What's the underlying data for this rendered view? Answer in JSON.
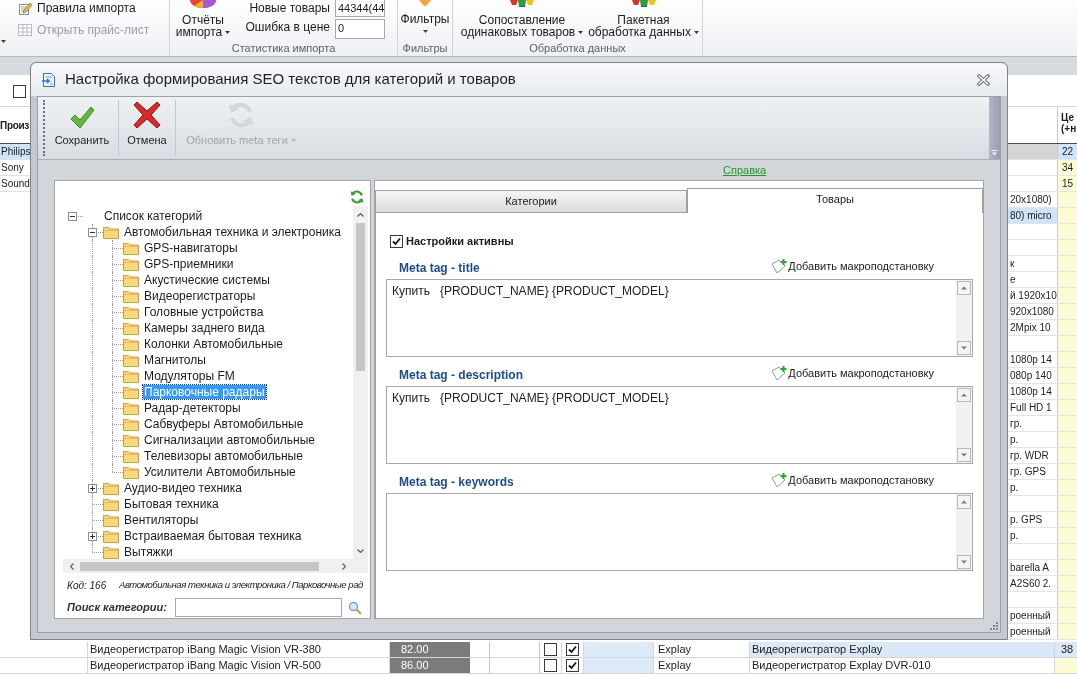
{
  "ribbon": {
    "import_group": {
      "items": [
        {
          "label": "Правила импорта",
          "disabled": false
        },
        {
          "label": "Открыть прайс-лист",
          "disabled": true
        }
      ]
    },
    "stats_group": {
      "label": "Статистика импорта",
      "report_button": {
        "lines": [
          "Отчёты",
          "импорта"
        ]
      },
      "fields": [
        {
          "label": "Новые товары",
          "value": "44344(44"
        },
        {
          "label": "Ошибка в цене",
          "value": "0"
        }
      ]
    },
    "filter_group": {
      "label": "Фильтры",
      "button": {
        "lines": [
          "Фильтры"
        ]
      }
    },
    "processing_group": {
      "label": "Обработка данных",
      "buttons": [
        {
          "lines": [
            "Сопоставление",
            "одинаковых товаров"
          ]
        },
        {
          "lines": [
            "Пакетная",
            "обработка данных"
          ]
        }
      ]
    }
  },
  "background_grid": {
    "filter_checkbox": {
      "checked": false
    },
    "left_header": "Произ",
    "left_rows": [
      {
        "text": "Philips",
        "selected": true
      },
      {
        "text": "Sony",
        "selected": false
      },
      {
        "text": "Sound",
        "selected": false
      }
    ],
    "right_header": [
      "Це",
      "(+н"
    ],
    "right_rows": [
      {
        "price": "22",
        "selected": true,
        "highlighted": false
      },
      {
        "price": "34",
        "selected": false,
        "highlighted": false
      },
      {
        "price": "15",
        "selected": false,
        "highlighted": false
      },
      {
        "text": "20x1080)",
        "selected": false,
        "highlighted": false
      },
      {
        "text": "80) micro",
        "selected": false,
        "highlighted": true
      },
      {
        "selected": false,
        "highlighted": false
      },
      {
        "selected": false,
        "highlighted": false
      },
      {
        "text": "к",
        "selected": false,
        "highlighted": false
      },
      {
        "text": "е",
        "selected": false,
        "highlighted": false
      },
      {
        "text": "й 1920x10",
        "selected": false,
        "highlighted": false
      },
      {
        "text": "920x1080",
        "selected": false,
        "highlighted": false
      },
      {
        "text": "2Mpix 10",
        "selected": false,
        "highlighted": false
      },
      {
        "selected": false,
        "highlighted": false
      },
      {
        "text": "1080p 14",
        "selected": false,
        "highlighted": false
      },
      {
        "text": "080p 140",
        "selected": false,
        "highlighted": false
      },
      {
        "text": "1080p 14",
        "selected": false,
        "highlighted": false
      },
      {
        "text": "Full HD 1",
        "selected": false,
        "highlighted": false
      },
      {
        "text": "гр.",
        "selected": false,
        "highlighted": false
      },
      {
        "text": "р.",
        "selected": false,
        "highlighted": false
      },
      {
        "text": "гр. WDR",
        "selected": false,
        "highlighted": false
      },
      {
        "text": "гр. GPS",
        "selected": false,
        "highlighted": false
      },
      {
        "text": "р.",
        "selected": false,
        "highlighted": false
      },
      {
        "selected": false,
        "highlighted": false
      },
      {
        "text": "р. GPS",
        "selected": false,
        "highlighted": false
      },
      {
        "text": "р.",
        "selected": false,
        "highlighted": false
      },
      {
        "selected": false,
        "highlighted": false
      },
      {
        "text": "barella A",
        "selected": false,
        "highlighted": false
      },
      {
        "text": "A2S60 2.",
        "selected": false,
        "highlighted": false
      },
      {
        "selected": false,
        "highlighted": false
      },
      {
        "text": "роенный",
        "selected": false,
        "highlighted": false
      },
      {
        "text": "роенный",
        "selected": false,
        "highlighted": false
      }
    ],
    "bottom_rows": [
      {
        "name": "Видеорегистратор iBang Magic Vision VR-380",
        "price": "82.00",
        "checkboxes": [
          {
            "checked": false
          },
          {
            "checked": true
          }
        ],
        "color": "#dce9f7",
        "maker": "Explay",
        "product": "Видеорегистратор Explay",
        "cost": "38",
        "selected": true
      },
      {
        "name": "Видеорегистратор iBang Magic Vision VR-500",
        "price": "86.00",
        "checkboxes": [
          {
            "checked": false
          },
          {
            "checked": true
          }
        ],
        "color": "#dce9f7",
        "maker": "Explay",
        "product": "Видеорегистратор Explay DVR-010",
        "selected": false
      }
    ]
  },
  "dialog": {
    "title": "Настройка формирования SEO текстов для категорий и товаров",
    "toolbar": [
      {
        "label": "Сохранить",
        "disabled": false,
        "dropdown": false
      },
      {
        "label": "Отмена",
        "disabled": false,
        "dropdown": false
      },
      {
        "label": "Обновить meta теги",
        "disabled": true,
        "dropdown": true
      }
    ],
    "help_link": "Справка",
    "tree": [
      {
        "label": "Список категорий",
        "expanded": true,
        "selected": false,
        "children": [
          {
            "label": "Автомобильная техника и электроника",
            "expanded": true,
            "selected": false,
            "children": [
              {
                "label": "GPS-навигаторы",
                "selected": false
              },
              {
                "label": "GPS-приемники",
                "selected": false
              },
              {
                "label": "Акустические системы",
                "selected": false
              },
              {
                "label": "Видеорегистраторы",
                "selected": false
              },
              {
                "label": "Головные устройства",
                "selected": false
              },
              {
                "label": "Камеры заднего вида",
                "selected": false
              },
              {
                "label": "Колонки Автомобильные",
                "selected": false
              },
              {
                "label": "Магнитолы",
                "selected": false
              },
              {
                "label": "Модуляторы FM",
                "selected": false
              },
              {
                "label": "Парковочные радары",
                "selected": true
              },
              {
                "label": "Радар-детекторы",
                "selected": false
              },
              {
                "label": "Сабвуферы Автомобильные",
                "selected": false
              },
              {
                "label": "Сигнализации автомобильные",
                "selected": false
              },
              {
                "label": "Телевизоры автомобильные",
                "selected": false
              },
              {
                "label": "Усилители Автомобильные",
                "selected": false
              }
            ]
          },
          {
            "label": "Аудио-видео техника",
            "expanded": false,
            "selected": false
          },
          {
            "label": "Бытовая техника",
            "selected": false
          },
          {
            "label": "Вентиляторы",
            "selected": false
          },
          {
            "label": "Встраиваемая бытовая техника",
            "expanded": false,
            "selected": false
          },
          {
            "label": "Вытяжки",
            "selected": false
          }
        ]
      }
    ],
    "status": {
      "code": "Код: 166",
      "path": "Автомобильная техника и электроника / Парковочные рад"
    },
    "search": {
      "label": "Поиск категории:"
    },
    "tabs": [
      {
        "label": "Категории",
        "selected": false
      },
      {
        "label": "Товары",
        "selected": true
      }
    ],
    "active_checkbox": {
      "label": "Настройки активны",
      "checked": true
    },
    "meta_fields": [
      {
        "label": "Meta tag - title",
        "action": "Добавить макроподстановку",
        "value": "Купить   {PRODUCT_NAME} {PRODUCT_MODEL}"
      },
      {
        "label": "Meta tag - description",
        "action": "Добавить макроподстановку",
        "value": "Купить   {PRODUCT_NAME} {PRODUCT_MODEL}"
      },
      {
        "label": "Meta tag - keywords",
        "action": "Добавить макроподстановку"
      }
    ]
  }
}
